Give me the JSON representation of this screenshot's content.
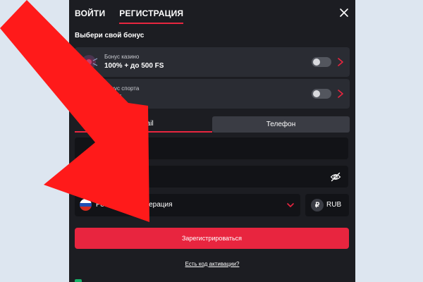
{
  "tabs": {
    "login": "ВОЙТИ",
    "register": "РЕГИСТРАЦИЯ"
  },
  "bonus": {
    "title": "Выбери свой бонус",
    "casino": {
      "label": "Бонус казино",
      "value": "100% + до 500 FS"
    },
    "sport": {
      "label": "Бонус спорта",
      "value": "150%"
    }
  },
  "method": {
    "email": "E-mail",
    "phone": "Телефон"
  },
  "country": {
    "name": "Российская Федерация"
  },
  "currency": {
    "symbol": "₽",
    "code": "RUB"
  },
  "submit": "Зарегистрироваться",
  "promo": "Есть код активации?",
  "colors": {
    "accent": "#e8253f",
    "panel": "#1c1d22",
    "card": "#2a2c33",
    "field": "#121317",
    "backdrop": "#dde6f0",
    "arrow": "#ff1a1a"
  },
  "icons": [
    "close-icon",
    "casino-bonus-icon",
    "sport-bonus-icon",
    "chevron-right-icon",
    "eye-off-icon",
    "russia-flag-icon",
    "chevron-down-icon",
    "ruble-icon",
    "red-arrow-overlay"
  ]
}
